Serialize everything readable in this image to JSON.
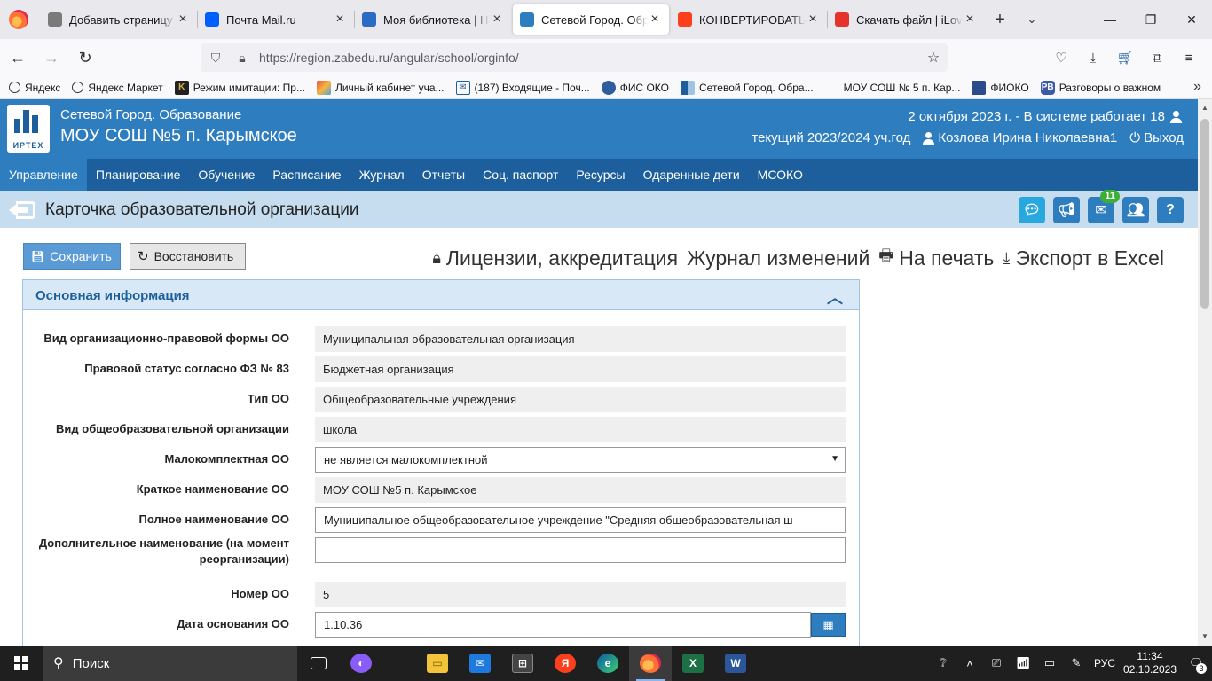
{
  "browser": {
    "tabs": [
      {
        "title": "Добавить страницу « ",
        "icon": "wordpress-icon",
        "color": "#7a7a7a",
        "active": false
      },
      {
        "title": "Почта Mail.ru",
        "icon": "mail-icon",
        "color": "#005ff9",
        "active": false
      },
      {
        "title": "Моя библиотека | НЭБ",
        "icon": "neb-icon",
        "color": "#2a6bc4",
        "active": false
      },
      {
        "title": "Сетевой Город. Образо",
        "icon": "netcity-icon",
        "color": "#2e7dbf",
        "active": true
      },
      {
        "title": "КОНВЕРТИРОВАТЬ ВС",
        "icon": "yandex-icon",
        "color": "#fc3f1d",
        "active": false
      },
      {
        "title": "Скачать файл | iLoveP",
        "icon": "heart-icon",
        "color": "#e5322d",
        "active": false
      }
    ],
    "url": "https://region.zabedu.ru/angular/school/orginfo/",
    "bookmarks": [
      {
        "label": "Яндекс",
        "icon": "globe-icon"
      },
      {
        "label": "Яндекс Маркет",
        "icon": "globe-icon"
      },
      {
        "label": "Режим имитации: Пр...",
        "icon": "k-icon"
      },
      {
        "label": "Личный кабинет уча...",
        "icon": "cube-icon"
      },
      {
        "label": "(187) Входящие - Поч...",
        "icon": "mail-icon"
      },
      {
        "label": "ФИС ОКО",
        "icon": "shield-icon"
      },
      {
        "label": "Сетевой Город. Обра...",
        "icon": "netcity-icon"
      },
      {
        "label": "МОУ СОШ № 5 п. Кар...",
        "icon": "blank-icon"
      },
      {
        "label": "ФИОКО",
        "icon": "fioko-icon"
      },
      {
        "label": "Разговоры о важном",
        "icon": "rv-icon"
      }
    ]
  },
  "app": {
    "logo_text": "ИРТЕХ",
    "app_name": "Сетевой Город. Образование",
    "school_name": "МОУ СОШ №5 п. Карымское",
    "date_status": "2 октября 2023 г. - В системе работает 18",
    "year": "текущий 2023/2024 уч.год",
    "user": "Козлова Ирина Николаевна1",
    "logout": "Выход",
    "menu": [
      "Управление",
      "Планирование",
      "Обучение",
      "Расписание",
      "Журнал",
      "Отчеты",
      "Соц. паспорт",
      "Ресурсы",
      "Одаренные дети",
      "МСОКО"
    ],
    "page_title": "Карточка образовательной организации",
    "mail_count": "11",
    "buttons": {
      "save": "Сохранить",
      "restore": "Восстановить"
    },
    "links": {
      "licenses": "Лицензии, аккредитация",
      "changelog": "Журнал изменений",
      "print": "На печать",
      "export": "Экспорт в Excel"
    },
    "panel_title": "Основная информация",
    "fields": [
      {
        "label": "Вид организационно-правовой формы ОО",
        "value": "Муниципальная образовательная организация",
        "kind": "static"
      },
      {
        "label": "Правовой статус согласно ФЗ № 83",
        "value": "Бюджетная организация",
        "kind": "static"
      },
      {
        "label": "Тип ОО",
        "value": "Общеобразовательные учреждения",
        "kind": "static"
      },
      {
        "label": "Вид общеобразовательной организации",
        "value": "школа",
        "kind": "static"
      },
      {
        "label": "Малокомплектная ОО",
        "value": "не является малокомплектной",
        "kind": "select"
      },
      {
        "label": "Краткое наименование ОО",
        "value": "МОУ СОШ №5 п. Карымское",
        "kind": "static"
      },
      {
        "label": "Полное наименование ОО",
        "value": "Муниципальное общеобразовательное учреждение \"Средняя общеобразовательная ш",
        "kind": "input"
      },
      {
        "label": "Дополнительное наименование (на момент реорганизации)",
        "value": "",
        "kind": "input"
      },
      {
        "label": "Номер ОО",
        "value": "5",
        "kind": "static"
      },
      {
        "label": "Дата основания ОО",
        "value": "1.10.36",
        "kind": "date"
      }
    ]
  },
  "taskbar": {
    "search": "Поиск",
    "lang": "РУС",
    "time": "11:34",
    "date": "02.10.2023",
    "notifications": "3"
  }
}
